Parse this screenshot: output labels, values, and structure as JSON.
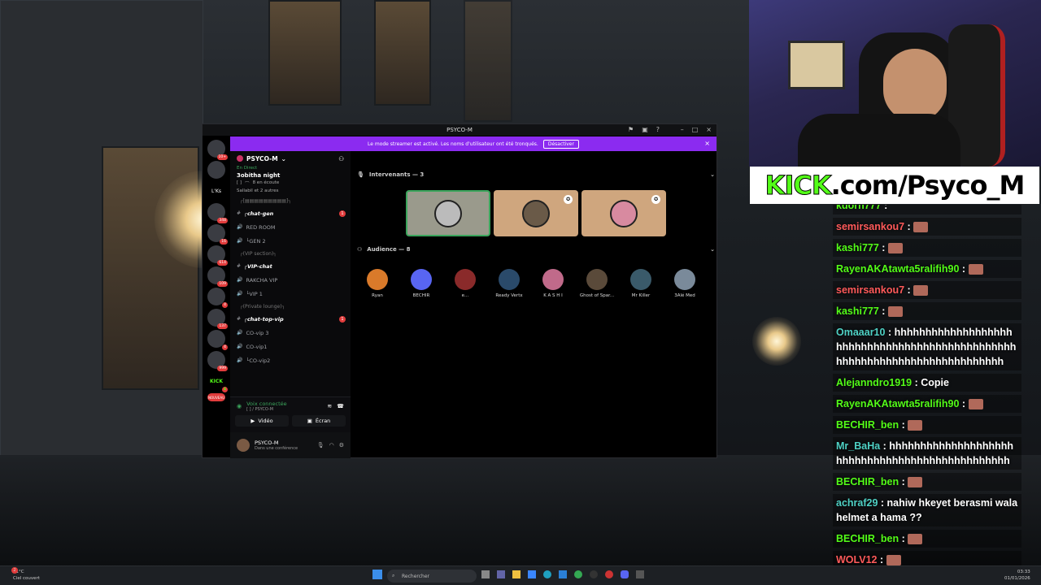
{
  "stream": {
    "kick_banner_prefix": "KICK",
    "kick_banner_suffix": ".com/Psyco_M"
  },
  "discord": {
    "window_title": "PSYCO-M",
    "streamer_banner": {
      "text": "Le mode streamer est activé. Les noms d'utilisateur ont été tronqués.",
      "button": "Désactiver",
      "close": "×"
    },
    "servers": [
      {
        "label": "",
        "badge": "10+"
      },
      {
        "label": "",
        "badge": ""
      },
      {
        "label": "L'Ks",
        "badge": ""
      },
      {
        "label": "",
        "badge": "348"
      },
      {
        "label": "",
        "badge": "16"
      },
      {
        "label": "",
        "badge": "614"
      },
      {
        "label": "",
        "badge": "109"
      },
      {
        "label": "",
        "badge": "4"
      },
      {
        "label": "",
        "badge": "137"
      },
      {
        "label": "",
        "badge": "4"
      },
      {
        "label": "",
        "badge": "999"
      },
      {
        "label": "KICK",
        "badge": "4"
      },
      {
        "label": "NOUVEAU",
        "badge": ""
      }
    ],
    "server_name": "PSYCO-M",
    "event": {
      "status": "En Direct",
      "title": "3obitha night",
      "stage_name": "[ ] ",
      "listeners": "8 en écoute",
      "attendees": "Sallabil et 2 autres"
    },
    "channels": [
      {
        "type": "category",
        "name": "┌[▤▤▤▤▤▤▤▤▤]┐"
      },
      {
        "type": "text",
        "name": "┌chat-gen",
        "badge": "1"
      },
      {
        "type": "voice",
        "name": "RED ROOM"
      },
      {
        "type": "voice",
        "name": "└GEN 2"
      },
      {
        "type": "category",
        "name": "┌(VIP section)┐"
      },
      {
        "type": "text",
        "name": "┌VIP-chat"
      },
      {
        "type": "voice",
        "name": "RAKCHA VIP"
      },
      {
        "type": "voice",
        "name": "└VIP 1"
      },
      {
        "type": "category",
        "name": "┌(Private lounge)┐"
      },
      {
        "type": "text",
        "name": "┌chat-top-vip",
        "badge": "1"
      },
      {
        "type": "voice",
        "name": "CO-vip 3"
      },
      {
        "type": "voice",
        "name": "CO-vip1"
      },
      {
        "type": "voice",
        "name": "└CO-vip2"
      }
    ],
    "voice_panel": {
      "status": "Voix connectée",
      "location": "[ ] / PSYCO-M",
      "video_label": "Vidéo",
      "screen_label": "Écran"
    },
    "user_panel": {
      "name": "PSYCO-M",
      "status": "Dans une conférence"
    },
    "stage": {
      "speakers_header": "Intervenants — 3",
      "audience_header": "Audience — 8",
      "audience": [
        "Ryan",
        "BECHIR",
        "e...",
        "Ready Vertx",
        "K A S H I",
        "Ghost of Spar...",
        "Mr Killer",
        "3Alé Med"
      ]
    }
  },
  "chat": {
    "messages": [
      {
        "user": "kdorh777",
        "color": "#53fc18",
        "text": "",
        "emote": false,
        "partial": true
      },
      {
        "user": "semirsankou7",
        "color": "#ff5a5a",
        "text": "",
        "emote": true
      },
      {
        "user": "kashi777",
        "color": "#53fc18",
        "text": "",
        "emote": true
      },
      {
        "user": "RayenAKAtawta5ralifih90",
        "color": "#53fc18",
        "text": "",
        "emote": true
      },
      {
        "user": "semirsankou7",
        "color": "#ff5a5a",
        "text": "",
        "emote": true
      },
      {
        "user": "kashi777",
        "color": "#53fc18",
        "text": "",
        "emote": true
      },
      {
        "user": "Omaaar10",
        "color": "#4fd1c5",
        "text": "hhhhhhhhhhhhhhhhhhhhhhhhhhhhhhhhhhhhhhhhhhhhhhhhhhhhhhhhhhhhhhhhhhhhhhhhhhh",
        "emote": false
      },
      {
        "user": "Alejanndro1919",
        "color": "#53fc18",
        "text": "Copie",
        "emote": false
      },
      {
        "user": "RayenAKAtawta5ralifih90",
        "color": "#53fc18",
        "text": "",
        "emote": true
      },
      {
        "user": "BECHIR_ben",
        "color": "#53fc18",
        "text": "",
        "emote": true
      },
      {
        "user": "Mr_BaHa",
        "color": "#4fd1c5",
        "text": "hhhhhhhhhhhhhhhhhhhhhhhhhhhhhhhhhhhhhhhhhhhhhhhh",
        "emote": false
      },
      {
        "user": "BECHIR_ben",
        "color": "#53fc18",
        "text": "",
        "emote": true
      },
      {
        "user": "achraf29",
        "color": "#4fd1c5",
        "text": "nahiw hkeyet berasmi wala helmet a hama ??",
        "emote": false
      },
      {
        "user": "BECHIR_ben",
        "color": "#53fc18",
        "text": "",
        "emote": true
      },
      {
        "user": "WOLV12",
        "color": "#ff5a5a",
        "text": "",
        "emote": true
      }
    ]
  },
  "taskbar": {
    "weather_temp": "11°C",
    "weather_desc": "Ciel couvert",
    "search_placeholder": "Rechercher",
    "time": "03:33",
    "date": "01/01/2026",
    "notif_badge": "2"
  }
}
